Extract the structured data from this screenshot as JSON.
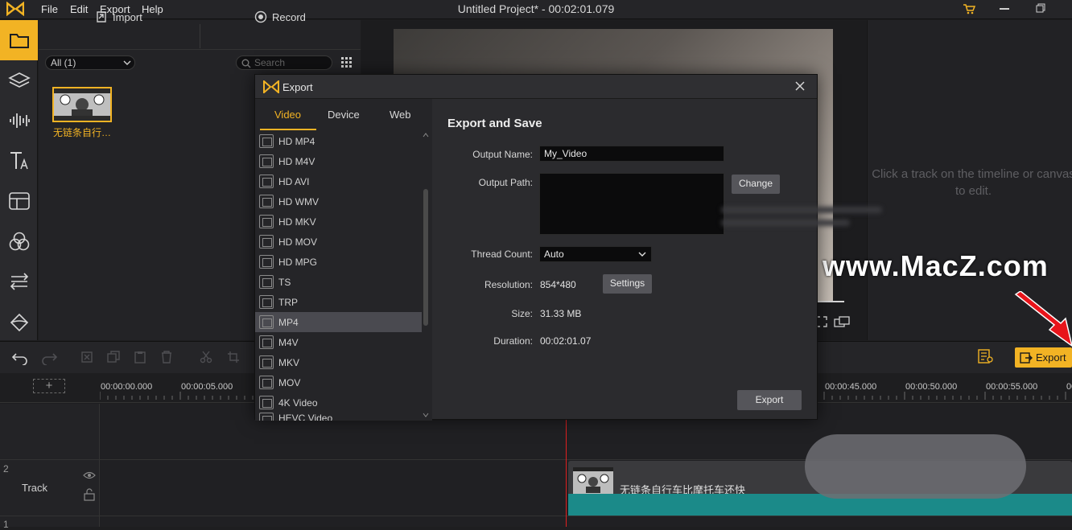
{
  "menu": {
    "file": "File",
    "edit": "Edit",
    "export": "Export",
    "help": "Help"
  },
  "window_title": "Untitled Project* - 00:02:01.079",
  "media": {
    "import_label": "Import",
    "record_label": "Record",
    "filter_value": "All (1)",
    "search_placeholder": "Search",
    "clip_caption": "无链条自行…"
  },
  "preview": {
    "hint": "Click a track on the timeline or canvas to edit."
  },
  "timeline": {
    "export_label": "Export",
    "ticks": [
      "00:00:00.000",
      "00:00:05.000",
      "00:00:45.000",
      "00:00:50.000",
      "00:00:55.000",
      "00"
    ],
    "track_number": "2",
    "track_name": "Track",
    "track_number_2": "1",
    "clip_title": "无链条自行车比摩托车还快"
  },
  "dialog": {
    "title": "Export",
    "tabs": [
      "Video",
      "Device",
      "Web"
    ],
    "formats": [
      "HD MP4",
      "HD M4V",
      "HD AVI",
      "HD WMV",
      "HD MKV",
      "HD MOV",
      "HD MPG",
      "TS",
      "TRP",
      "MP4",
      "M4V",
      "MKV",
      "MOV",
      "4K Video",
      "HEVC Video"
    ],
    "selected_format": "MP4",
    "heading": "Export and Save",
    "output_name_label": "Output Name:",
    "output_name_value": "My_Video",
    "output_path_label": "Output Path:",
    "change_label": "Change",
    "thread_count_label": "Thread Count:",
    "thread_count_value": "Auto",
    "resolution_label": "Resolution:",
    "resolution_value": "854*480",
    "settings_label": "Settings",
    "size_label": "Size:",
    "size_value": "31.33 MB",
    "duration_label": "Duration:",
    "duration_value": "00:02:01.07",
    "export_label": "Export"
  },
  "watermark": "www.MacZ.com",
  "colors": {
    "accent": "#f2b324",
    "arrow": "#e8141a",
    "wave": "#1b8a89"
  }
}
